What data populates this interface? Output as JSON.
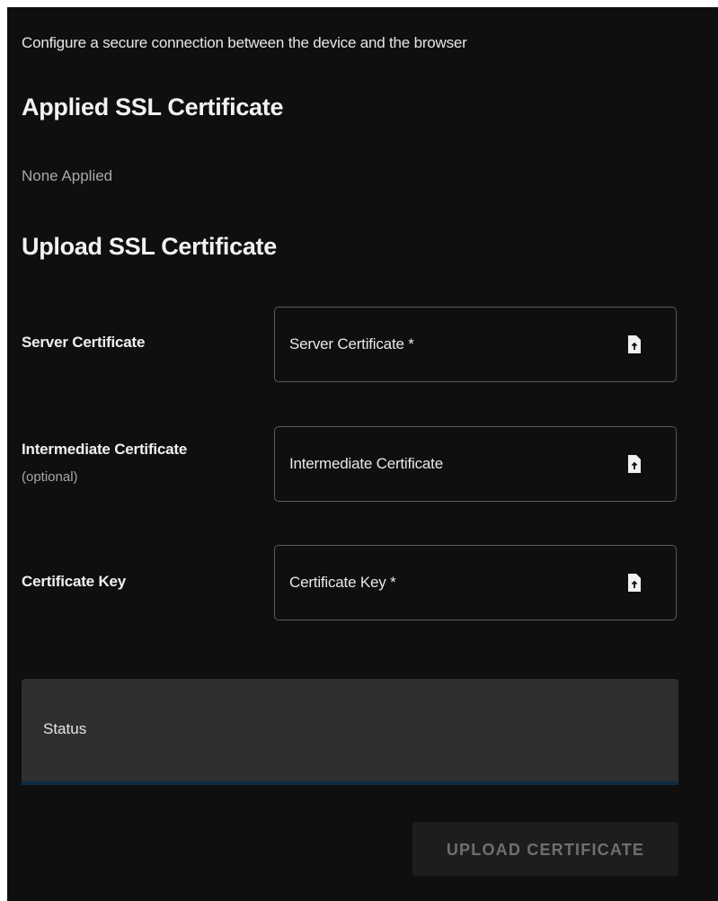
{
  "intro": "Configure a secure connection between the device and the browser",
  "applied": {
    "heading": "Applied SSL Certificate",
    "value": "None Applied"
  },
  "upload": {
    "heading": "Upload SSL Certificate",
    "rows": [
      {
        "label": "Server Certificate",
        "sublabel": "",
        "field_placeholder": "Server Certificate *",
        "icon": "file-upload-icon"
      },
      {
        "label": "Intermediate Certificate",
        "sublabel": "(optional)",
        "field_placeholder": "Intermediate Certificate",
        "icon": "file-upload-icon"
      },
      {
        "label": "Certificate Key",
        "sublabel": "",
        "field_placeholder": "Certificate Key *",
        "icon": "file-upload-icon"
      }
    ],
    "status_label": "Status",
    "button_label": "UPLOAD CERTIFICATE",
    "button_enabled": false
  },
  "colors": {
    "background": "#0f0f0f",
    "status_fill": "#2f2f2f",
    "status_underline": "#0d2a45",
    "button_disabled_text": "#6f6f6f"
  }
}
